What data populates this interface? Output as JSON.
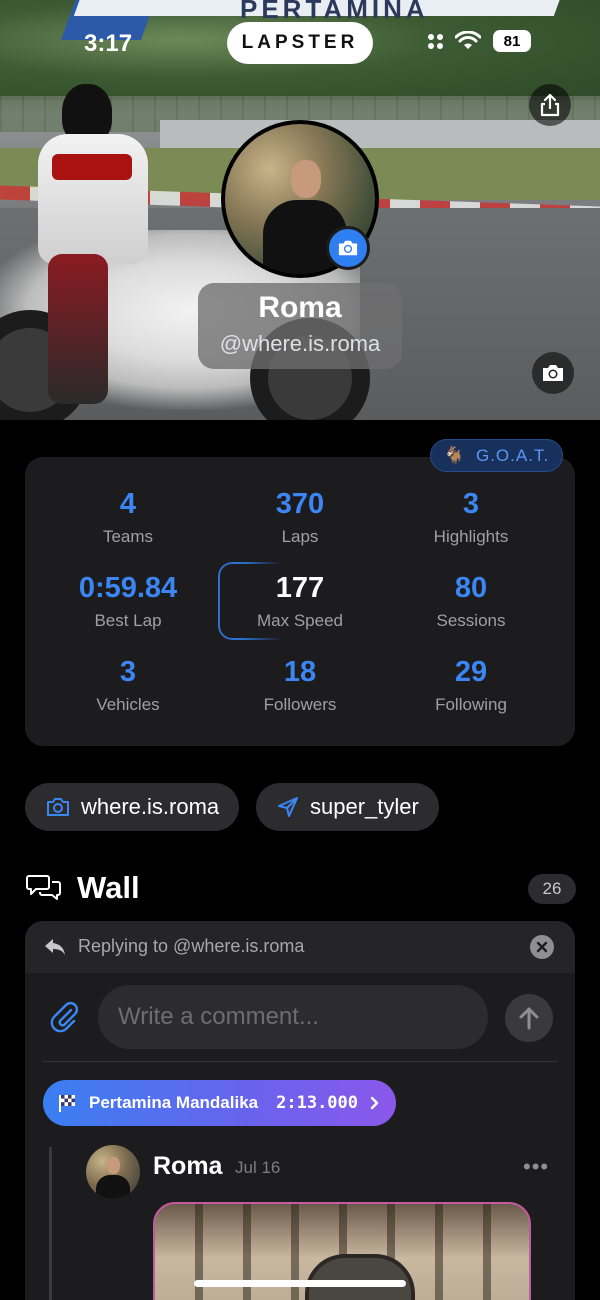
{
  "status_bar": {
    "time": "3:17",
    "battery": "81"
  },
  "app": {
    "logo": "LAPSTER"
  },
  "hero": {
    "banner_text": "PERTAMINA"
  },
  "profile": {
    "name": "Roma",
    "handle": "@where.is.roma",
    "badge_label": "G.O.A.T.",
    "badge_emoji": "🐐"
  },
  "stats": [
    {
      "value": "4",
      "label": "Teams"
    },
    {
      "value": "370",
      "label": "Laps"
    },
    {
      "value": "3",
      "label": "Highlights"
    },
    {
      "value": "0:59.84",
      "label": "Best Lap"
    },
    {
      "value": "177",
      "label": "Max Speed"
    },
    {
      "value": "80",
      "label": "Sessions"
    },
    {
      "value": "3",
      "label": "Vehicles"
    },
    {
      "value": "18",
      "label": "Followers"
    },
    {
      "value": "29",
      "label": "Following"
    }
  ],
  "socials": [
    {
      "platform": "instagram",
      "icon": "camera-icon",
      "handle": "where.is.roma"
    },
    {
      "platform": "telegram",
      "icon": "paper-plane-icon",
      "handle": "super_tyler"
    }
  ],
  "wall": {
    "title": "Wall",
    "count": "26",
    "replying_to": "Replying to @where.is.roma",
    "comment_placeholder": "Write a comment...",
    "session": {
      "track": "Pertamina Mandalika",
      "time": "2:13.000"
    },
    "post": {
      "author": "Roma",
      "date": "Jul 16",
      "more": "•••"
    }
  },
  "colors": {
    "accent": "#2F7FF0",
    "stat_value": "#3B86F3",
    "card": "#1C1C1E",
    "chip": "#2C2C2E",
    "background": "#000000"
  }
}
